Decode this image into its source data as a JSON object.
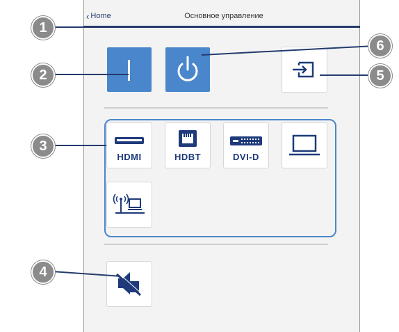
{
  "header": {
    "back_label": "Home",
    "title": "Основное управление"
  },
  "controls": {
    "av_mute_icon": "vertical-bar-icon",
    "power_icon": "power-icon",
    "source_search_icon": "input-arrow-icon"
  },
  "sources": [
    {
      "label": "HDMI",
      "icon": "hdmi-port-icon"
    },
    {
      "label": "HDBT",
      "icon": "ethernet-port-icon"
    },
    {
      "label": "DVI-D",
      "icon": "dvi-port-icon"
    },
    {
      "label": "",
      "icon": "laptop-icon"
    },
    {
      "label": "",
      "icon": "wireless-network-icon"
    }
  ],
  "callouts": [
    "1",
    "2",
    "3",
    "4",
    "5",
    "6"
  ],
  "colors": {
    "accent": "#4a86cb",
    "navy": "#243b6e",
    "callout": "#8b8b8b"
  }
}
